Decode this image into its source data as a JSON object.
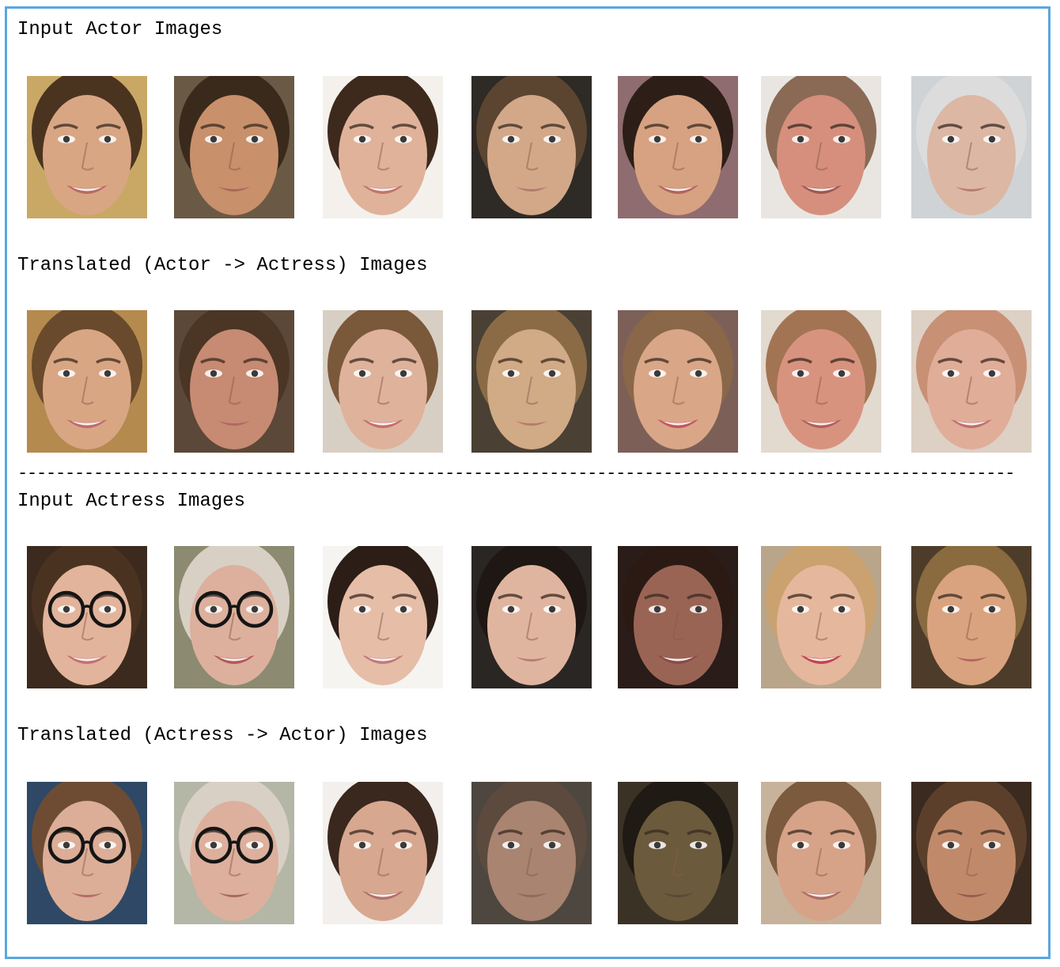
{
  "sections": [
    {
      "heading": "Input Actor Images",
      "faces": [
        {
          "name": "input-actor-face-1",
          "bg": "#c9a865",
          "skin": "#d9a684",
          "hair": "#4a3420",
          "lips": "#b96b62",
          "glasses": false,
          "smile": true
        },
        {
          "name": "input-actor-face-2",
          "bg": "#6a5a45",
          "skin": "#c8906b",
          "hair": "#3a2a1c",
          "lips": "#a9675a",
          "glasses": false,
          "smile": false
        },
        {
          "name": "input-actor-face-3",
          "bg": "#f4f1ec",
          "skin": "#e0b29a",
          "hair": "#3d2a1d",
          "lips": "#c0756c",
          "glasses": false,
          "smile": true
        },
        {
          "name": "input-actor-face-4",
          "bg": "#2e2a25",
          "skin": "#d2a889",
          "hair": "#5b4530",
          "lips": "#b27a6a",
          "glasses": false,
          "smile": false
        },
        {
          "name": "input-actor-face-5",
          "bg": "#8f6c6f",
          "skin": "#d7a281",
          "hair": "#2d1f17",
          "lips": "#b5645c",
          "glasses": false,
          "smile": true
        },
        {
          "name": "input-actor-face-6",
          "bg": "#e9e6e2",
          "skin": "#d68f7c",
          "hair": "#8a6a55",
          "lips": "#a2574f",
          "glasses": false,
          "smile": true
        },
        {
          "name": "input-actor-face-7",
          "bg": "#cfd3d6",
          "skin": "#dcb7a4",
          "hair": "#dcdcdc",
          "lips": "#b57b73",
          "glasses": false,
          "smile": false
        }
      ]
    },
    {
      "heading": "Translated (Actor -> Actress) Images",
      "faces": [
        {
          "name": "translated-actress-face-1",
          "bg": "#b48a4f",
          "skin": "#d9a684",
          "hair": "#6a4a2c",
          "lips": "#c06b6b",
          "glasses": false,
          "smile": true
        },
        {
          "name": "translated-actress-face-2",
          "bg": "#5b4838",
          "skin": "#c78a72",
          "hair": "#4b3525",
          "lips": "#b0666a",
          "glasses": false,
          "smile": false
        },
        {
          "name": "translated-actress-face-3",
          "bg": "#d8cfc4",
          "skin": "#dfb29b",
          "hair": "#7a583a",
          "lips": "#c76e6e",
          "glasses": false,
          "smile": true
        },
        {
          "name": "translated-actress-face-4",
          "bg": "#4a4034",
          "skin": "#d1aa86",
          "hair": "#8a6b45",
          "lips": "#b57b6b",
          "glasses": false,
          "smile": false
        },
        {
          "name": "translated-actress-face-5",
          "bg": "#7c6058",
          "skin": "#d9a787",
          "hair": "#8a6748",
          "lips": "#c4575b",
          "glasses": false,
          "smile": true
        },
        {
          "name": "translated-actress-face-6",
          "bg": "#e2d9cf",
          "skin": "#d8937f",
          "hair": "#a27453",
          "lips": "#b3605a",
          "glasses": false,
          "smile": true
        },
        {
          "name": "translated-actress-face-7",
          "bg": "#ddd0c4",
          "skin": "#e0ad98",
          "hair": "#c89075",
          "lips": "#c06f70",
          "glasses": false,
          "smile": true
        }
      ]
    },
    {
      "heading": "Input Actress Images",
      "faces": [
        {
          "name": "input-actress-face-1",
          "bg": "#3b2a1d",
          "skin": "#e2b49b",
          "hair": "#4a3221",
          "lips": "#c27273",
          "glasses": true,
          "smile": true
        },
        {
          "name": "input-actress-face-2",
          "bg": "#8c8a70",
          "skin": "#dcb09d",
          "hair": "#d8d0c4",
          "lips": "#b45a58",
          "glasses": true,
          "smile": true
        },
        {
          "name": "input-actress-face-3",
          "bg": "#f6f4f1",
          "skin": "#e6bda7",
          "hair": "#2c1d16",
          "lips": "#c27b7a",
          "glasses": false,
          "smile": true
        },
        {
          "name": "input-actress-face-4",
          "bg": "#2a2624",
          "skin": "#e0b59f",
          "hair": "#1f1713",
          "lips": "#b97a75",
          "glasses": false,
          "smile": false
        },
        {
          "name": "input-actress-face-5",
          "bg": "#2a1c18",
          "skin": "#9a6454",
          "hair": "#2b1a14",
          "lips": "#8b4a45",
          "glasses": false,
          "smile": true
        },
        {
          "name": "input-actress-face-6",
          "bg": "#b9a58a",
          "skin": "#e5b79c",
          "hair": "#c9a270",
          "lips": "#c2454e",
          "glasses": false,
          "smile": true
        },
        {
          "name": "input-actress-face-7",
          "bg": "#4e3c2a",
          "skin": "#d9a37f",
          "hair": "#8a6a3f",
          "lips": "#b56460",
          "glasses": false,
          "smile": false
        }
      ]
    },
    {
      "heading": "Translated (Actress -> Actor) Images",
      "faces": [
        {
          "name": "translated-actor-face-1",
          "bg": "#2f4866",
          "skin": "#dcae97",
          "hair": "#6e4c33",
          "lips": "#b46a67",
          "glasses": true,
          "smile": false
        },
        {
          "name": "translated-actor-face-2",
          "bg": "#b4b6a6",
          "skin": "#dcb09d",
          "hair": "#d8d0c4",
          "lips": "#aa6560",
          "glasses": true,
          "smile": false
        },
        {
          "name": "translated-actor-face-3",
          "bg": "#f2efec",
          "skin": "#d8a790",
          "hair": "#3a271d",
          "lips": "#b4716b",
          "glasses": false,
          "smile": true
        },
        {
          "name": "translated-actor-face-4",
          "bg": "#4d4740",
          "skin": "#a98470",
          "hair": "#5b4a3d",
          "lips": "#8f6a5f",
          "glasses": false,
          "smile": false
        },
        {
          "name": "translated-actor-face-5",
          "bg": "#3b3226",
          "skin": "#6c5a3c",
          "hair": "#1f1a14",
          "lips": "#5a4838",
          "glasses": false,
          "smile": false
        },
        {
          "name": "translated-actor-face-6",
          "bg": "#c7b29b",
          "skin": "#d6a388",
          "hair": "#7b5a3e",
          "lips": "#b06b62",
          "glasses": false,
          "smile": true
        },
        {
          "name": "translated-actor-face-7",
          "bg": "#3a2a20",
          "skin": "#c08a6a",
          "hair": "#5b3f2a",
          "lips": "#9a5a50",
          "glasses": false,
          "smile": false
        }
      ]
    }
  ],
  "divider": "---------------------------------------------------------------------------------------------------------"
}
